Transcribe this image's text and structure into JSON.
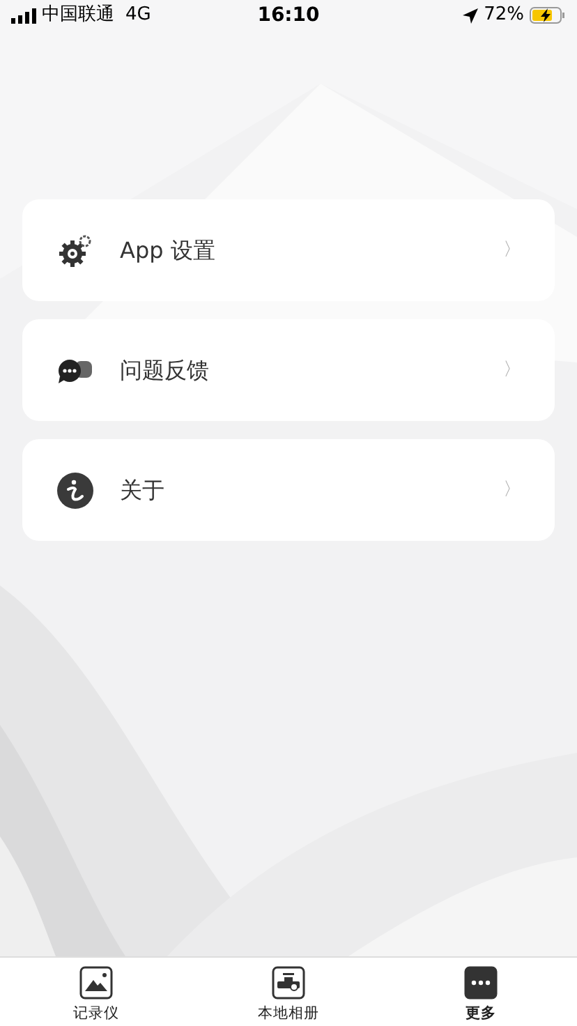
{
  "status_bar": {
    "carrier": "中国联通",
    "network": "4G",
    "time": "16:10",
    "battery": "72%"
  },
  "menu": [
    {
      "label": "App 设置",
      "chevron": "〉"
    },
    {
      "label": "问题反馈",
      "chevron": "〉"
    },
    {
      "label": "关于",
      "chevron": "〉"
    }
  ],
  "tab_bar": [
    {
      "label": "记录仪",
      "selected": false
    },
    {
      "label": "本地相册",
      "selected": false
    },
    {
      "label": "更多",
      "selected": true
    }
  ]
}
